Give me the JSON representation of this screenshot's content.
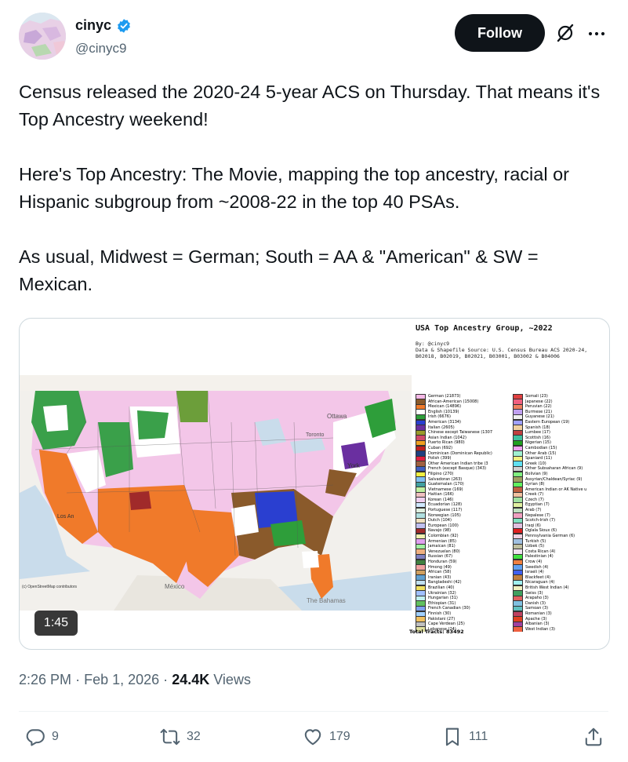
{
  "author": {
    "display_name": "cinyc",
    "handle": "@cinyc9",
    "verified": true,
    "avatar": "map-avatar",
    "follow_label": "Follow"
  },
  "icons": {
    "verified": "verified-badge-icon",
    "grok": "grok-icon",
    "more": "more-icon",
    "reply": "reply-icon",
    "repost": "repost-icon",
    "like": "like-icon",
    "bookmark": "bookmark-icon",
    "share": "share-icon"
  },
  "tweet": {
    "text": "Census released the 2020-24 5-year ACS on Thursday. That means it's Top Ancestry weekend!\n\nHere's Top Ancestry: The Movie, mapping the top ancestry, racial or Hispanic subgroup from ~2008-22 in the top 40 PSAs.\n\nAs usual, Midwest = German; South = AA & \"American\" & SW = Mexican."
  },
  "media": {
    "duration": "1:45",
    "map_title": "USA Top Ancestry Group, ~2022",
    "map_subtitle": "By: @cinyc9\nData & Shapefile Source: U.S. Census Bureau ACS 2020-24,\nB02018, B02019, B02021, B03001, B03002 & B04006",
    "osm_credit": "(c) OpenStreetMap contributors",
    "place_labels": [
      "Ottawa",
      "Toronto",
      "York",
      "Los An",
      "México",
      "The Bahamas"
    ],
    "total_tracts": "Total Tracts: 83492",
    "legend_left": [
      {
        "label": "German (21873)",
        "color": "#f5b8e6"
      },
      {
        "label": "African-American (15008)",
        "color": "#8a5a2b"
      },
      {
        "label": "Mexican (14896)",
        "color": "#f07a2a"
      },
      {
        "label": "English (10139)",
        "color": "#ffffff"
      },
      {
        "label": "Irish (6676)",
        "color": "#2e9e3a"
      },
      {
        "label": "American (3134)",
        "color": "#2a3fd0"
      },
      {
        "label": "Italian (2605)",
        "color": "#6a2fa0"
      },
      {
        "label": "Chinese except Taiwanese (1307",
        "color": "#9a9a2a"
      },
      {
        "label": "Asian Indian (1042)",
        "color": "#d04a6a"
      },
      {
        "label": "Puerto Rican (980)",
        "color": "#f0a020"
      },
      {
        "label": "Cuban (692)",
        "color": "#c02020"
      },
      {
        "label": "Dominican (Dominican Republic)",
        "color": "#204080"
      },
      {
        "label": "Polish (399)",
        "color": "#e02040"
      },
      {
        "label": "Other American Indian tribe (3",
        "color": "#a06040"
      },
      {
        "label": "French (except Basque) (343)",
        "color": "#4060c0"
      },
      {
        "label": "Filipino (270)",
        "color": "#f0f040"
      },
      {
        "label": "Salvadoran (263)",
        "color": "#80c0f0"
      },
      {
        "label": "Guatemalan (170)",
        "color": "#40a0a0"
      },
      {
        "label": "Vietnamese (169)",
        "color": "#c0f0a0"
      },
      {
        "label": "Haitian (166)",
        "color": "#f0c0c0"
      },
      {
        "label": "Korean (146)",
        "color": "#f0d0f0"
      },
      {
        "label": "Ecuadorian (128)",
        "color": "#d0e8ff"
      },
      {
        "label": "Portuguese (117)",
        "color": "#e0f0e0"
      },
      {
        "label": "Norwegian (105)",
        "color": "#b0e0e0"
      },
      {
        "label": "Dutch (104)",
        "color": "#f0e0c0"
      },
      {
        "label": "European (100)",
        "color": "#c0c0f0"
      },
      {
        "label": "Navajo (98)",
        "color": "#a02a2a"
      },
      {
        "label": "Colombian (92)",
        "color": "#f0f0b0"
      },
      {
        "label": "Armenian (85)",
        "color": "#e0a0f0"
      },
      {
        "label": "Jamaican (81)",
        "color": "#a0f0a0"
      },
      {
        "label": "Venezuelan (80)",
        "color": "#f0b080"
      },
      {
        "label": "Russian (67)",
        "color": "#8080c0"
      },
      {
        "label": "Honduran (59)",
        "color": "#408040"
      },
      {
        "label": "Hmong (49)",
        "color": "#f0a0a0"
      },
      {
        "label": "African (58)",
        "color": "#d0a060"
      },
      {
        "label": "Iranian (43)",
        "color": "#60a0d0"
      },
      {
        "label": "Bangladeshi (42)",
        "color": "#c0e0f0"
      },
      {
        "label": "Brazilian (40)",
        "color": "#f0e060"
      },
      {
        "label": "Ukrainian (32)",
        "color": "#a0c0ff"
      },
      {
        "label": "Hungarian (31)",
        "color": "#c0f0f0"
      },
      {
        "label": "Ethiopian (31)",
        "color": "#60c060"
      },
      {
        "label": "French Canadian (30)",
        "color": "#80a0f0"
      },
      {
        "label": "Finnish (30)",
        "color": "#a0d0ff"
      },
      {
        "label": "Pakistani (27)",
        "color": "#f0c060"
      },
      {
        "label": "Cape Verdean (25)",
        "color": "#c0c0c0"
      },
      {
        "label": "Lebanese (24)",
        "color": "#e0e0a0"
      }
    ],
    "legend_right": [
      {
        "label": "Somali (23)",
        "color": "#e04040"
      },
      {
        "label": "Japanese (22)",
        "color": "#f06080"
      },
      {
        "label": "Peruvian (22)",
        "color": "#f08060"
      },
      {
        "label": "Burmese (21)",
        "color": "#c0a0f0"
      },
      {
        "label": "Guyanese (21)",
        "color": "#f0f0f0"
      },
      {
        "label": "Eastern European (19)",
        "color": "#a0a0ff"
      },
      {
        "label": "Spanish (18)",
        "color": "#f0d0a0"
      },
      {
        "label": "Lumbee (17)",
        "color": "#c04040"
      },
      {
        "label": "Scottish (16)",
        "color": "#40c0a0"
      },
      {
        "label": "Nigerian (15)",
        "color": "#20a020"
      },
      {
        "label": "Cambodian (15)",
        "color": "#f0a0f0"
      },
      {
        "label": "Other Arab (15)",
        "color": "#a0f0d0"
      },
      {
        "label": "Spaniard (11)",
        "color": "#f0f080"
      },
      {
        "label": "Greek (10)",
        "color": "#60e0f0"
      },
      {
        "label": "Other Subsaharan African (9)",
        "color": "#d0d0d0"
      },
      {
        "label": "Bolivian (9)",
        "color": "#80f080"
      },
      {
        "label": "Assyrian/Chaldean/Syriac (9)",
        "color": "#a0a060"
      },
      {
        "label": "Syrian (8)",
        "color": "#60f060"
      },
      {
        "label": "American Indian or AK Native u",
        "color": "#c06040"
      },
      {
        "label": "Creek (7)",
        "color": "#f0c0a0"
      },
      {
        "label": "Czech (7)",
        "color": "#a0e0a0"
      },
      {
        "label": "Egyptian (7)",
        "color": "#e0f0a0"
      },
      {
        "label": "Arab (7)",
        "color": "#c0e0c0"
      },
      {
        "label": "Nepalese (7)",
        "color": "#f0a0c0"
      },
      {
        "label": "Scotch-Irish (7)",
        "color": "#80e0c0"
      },
      {
        "label": "Iraqi (6)",
        "color": "#e0c0e0"
      },
      {
        "label": "Oglala Sioux (6)",
        "color": "#e02020"
      },
      {
        "label": "Pennsylvania German (6)",
        "color": "#f0d0e0"
      },
      {
        "label": "Turkish (5)",
        "color": "#a0c0e0"
      },
      {
        "label": "Uzbek (5)",
        "color": "#c0c0a0"
      },
      {
        "label": "Costa Rican (4)",
        "color": "#f0e0f0"
      },
      {
        "label": "Palestinian (4)",
        "color": "#40e040"
      },
      {
        "label": "Crow (4)",
        "color": "#f08040"
      },
      {
        "label": "Swedish (4)",
        "color": "#60a0f0"
      },
      {
        "label": "Israeli (4)",
        "color": "#4060f0"
      },
      {
        "label": "Blackfeet (4)",
        "color": "#c08040"
      },
      {
        "label": "Nicaraguan (4)",
        "color": "#a0f0f0"
      },
      {
        "label": "British West Indian (4)",
        "color": "#f0f0c0"
      },
      {
        "label": "Swiss (3)",
        "color": "#40a060"
      },
      {
        "label": "Arapaho (3)",
        "color": "#e06060"
      },
      {
        "label": "Danish (3)",
        "color": "#80c0e0"
      },
      {
        "label": "Samoan (3)",
        "color": "#60c0c0"
      },
      {
        "label": "Romanian (3)",
        "color": "#c04060"
      },
      {
        "label": "Apache (3)",
        "color": "#e04020"
      },
      {
        "label": "Albanian (3)",
        "color": "#a040a0"
      },
      {
        "label": "West Indian (3)",
        "color": "#f06040"
      }
    ]
  },
  "meta": {
    "time": "2:26 PM",
    "sep1": "·",
    "date": "Feb 1, 2026",
    "sep2": "·",
    "views_count": "24.4K",
    "views_label": "Views"
  },
  "actions": {
    "replies": "9",
    "reposts": "32",
    "likes": "179",
    "bookmarks": "111"
  },
  "colors": {
    "text_primary": "#0f1419",
    "text_secondary": "#536471",
    "verified_blue": "#1d9bf0",
    "follow_bg": "#0f1419"
  }
}
